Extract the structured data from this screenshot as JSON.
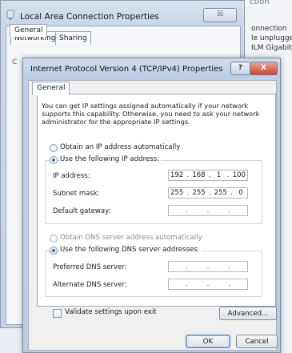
{
  "background_window": {
    "title_fragment": "ction",
    "lines": [
      "onnection",
      "le unplugge",
      "ILM Gigabit"
    ]
  },
  "outer_dialog": {
    "title": "Local Area Connection Properties",
    "close_label": "☒",
    "tabs": [
      {
        "label": "Networking",
        "active": true
      },
      {
        "label": "Sharing",
        "active": false
      }
    ],
    "ghost_text": "C"
  },
  "ipv4_dialog": {
    "title": "Internet Protocol Version 4 (TCP/IPv4) Properties",
    "help_label": "?",
    "close_label": "X",
    "tab": "General",
    "description": "You can get IP settings assigned automatically if your network supports this capability. Otherwise, you need to ask your network administrator for the appropriate IP settings.",
    "ip_mode": {
      "auto_label": "Obtain an IP address automatically",
      "manual_label": "Use the following IP address:",
      "selected": "manual"
    },
    "ip_fields": {
      "ip_address": {
        "label": "IP address:",
        "octets": [
          "192",
          "168",
          "1",
          "100"
        ]
      },
      "subnet_mask": {
        "label": "Subnet mask:",
        "octets": [
          "255",
          "255",
          "255",
          "0"
        ]
      },
      "default_gateway": {
        "label": "Default gateway:",
        "octets": [
          "",
          "",
          "",
          ""
        ]
      }
    },
    "dns_mode": {
      "auto_label": "Obtain DNS server address automatically",
      "manual_label": "Use the following DNS server addresses:",
      "selected": "manual"
    },
    "dns_fields": {
      "preferred": {
        "label": "Preferred DNS server:",
        "octets": [
          "",
          "",
          "",
          ""
        ]
      },
      "alternate": {
        "label": "Alternate DNS server:",
        "octets": [
          "",
          "",
          "",
          ""
        ]
      }
    },
    "validate": {
      "label": "Validate settings upon exit",
      "checked": false
    },
    "buttons": {
      "advanced": "Advanced...",
      "ok": "OK",
      "cancel": "Cancel"
    }
  },
  "colors": {
    "accent": "#2e6fc0",
    "close_red": "#c8462f",
    "window_frame": "#bccfe5"
  }
}
